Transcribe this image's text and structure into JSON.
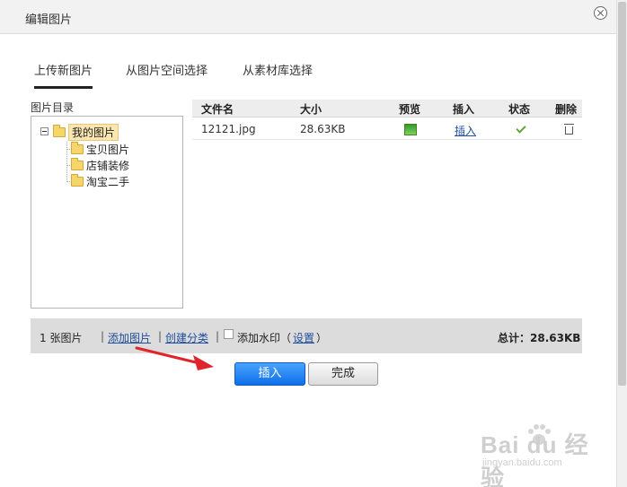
{
  "dialog": {
    "title": "编辑图片"
  },
  "tabs": [
    {
      "label": "上传新图片",
      "active": true
    },
    {
      "label": "从图片空间选择",
      "active": false
    },
    {
      "label": "从素材库选择",
      "active": false
    }
  ],
  "tree": {
    "label": "图片目录",
    "root": "我的图片",
    "children": [
      "宝贝图片",
      "店铺装修",
      "淘宝二手"
    ]
  },
  "file_table": {
    "columns": [
      "文件名",
      "大小",
      "预览",
      "插入",
      "状态",
      "删除"
    ],
    "rows": [
      {
        "name": "12121.jpg",
        "size": "28.63KB",
        "preview_icon": "image-preview-icon",
        "insert_label": "插入",
        "status_icon": "check-icon",
        "delete_icon": "trash-icon"
      }
    ]
  },
  "bottom_bar": {
    "count": "1 张图片",
    "sep": "|",
    "add_image": "添加图片",
    "create_category": "创建分类",
    "watermark_label": "添加水印（",
    "settings": "设置",
    "paren_close": "）",
    "total": "总计：28.63KB"
  },
  "buttons": {
    "insert": "插入",
    "done": "完成"
  },
  "watermark": {
    "brand": "Bai du 经验",
    "url": "jingyan.baidu.com"
  },
  "colors": {
    "primary_button": "#1573ea",
    "link": "#1f4e9c",
    "arrow": "#e0242b"
  }
}
